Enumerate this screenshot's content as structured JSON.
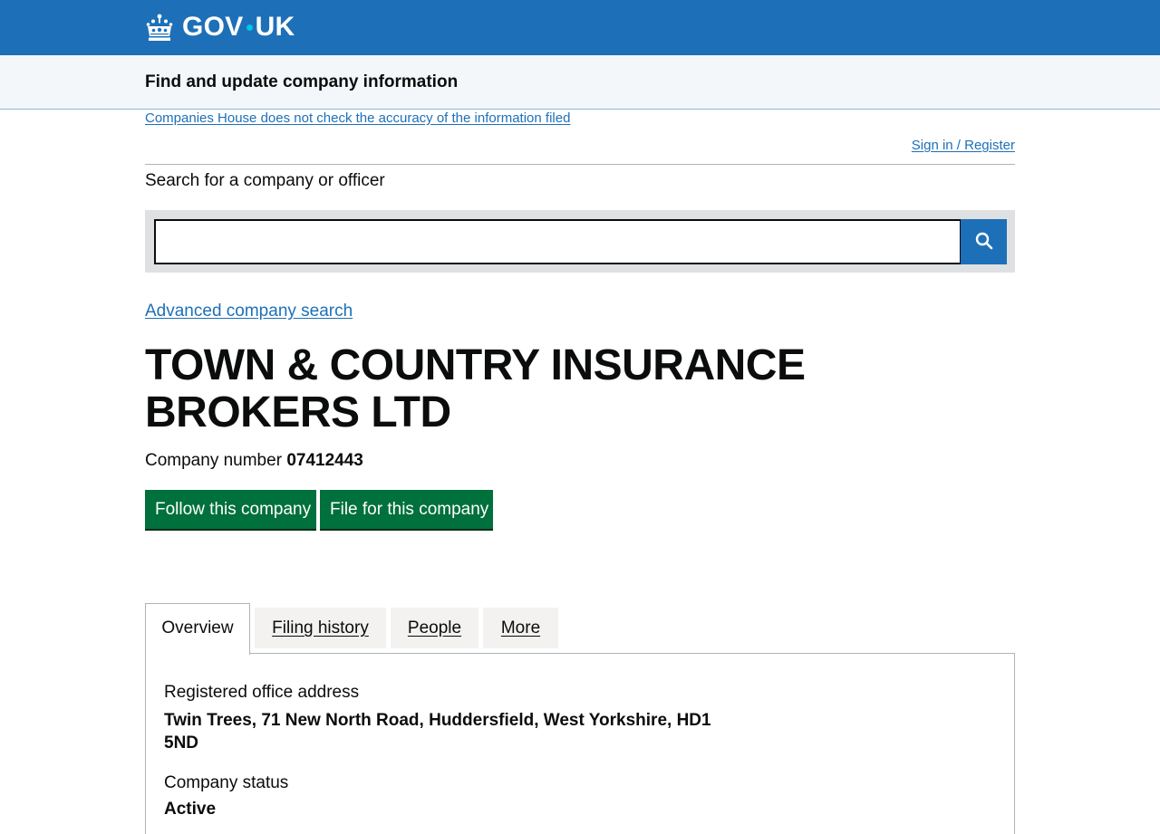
{
  "header": {
    "logo_text_left": "GOV",
    "logo_text_right": "UK",
    "logo_icon": "crown-icon",
    "brand_color": "#1d70b8"
  },
  "service": {
    "name": "Find and update company information"
  },
  "notice": {
    "disclaimer": "Companies House does not check the accuracy of the information filed",
    "sign_in": "Sign in / Register"
  },
  "search": {
    "label": "Search for a company or officer",
    "value": "",
    "button_icon": "search-icon",
    "advanced_link": "Advanced company search"
  },
  "company": {
    "name": "TOWN & COUNTRY INSURANCE BROKERS LTD",
    "number_label": "Company number",
    "number": "07412443"
  },
  "actions": {
    "follow": "Follow this company",
    "file": "File for this company",
    "button_color": "#00703c"
  },
  "tabs": [
    {
      "label": "Overview",
      "active": true
    },
    {
      "label": "Filing history",
      "active": false
    },
    {
      "label": "People",
      "active": false
    },
    {
      "label": "More",
      "active": false
    }
  ],
  "overview": {
    "address_label": "Registered office address",
    "address_line1": "Twin Trees, 71 New North Road, Huddersfield, West Yorkshire, HD1",
    "address_line2": "5ND",
    "status_label": "Company status",
    "status_value": "Active"
  }
}
